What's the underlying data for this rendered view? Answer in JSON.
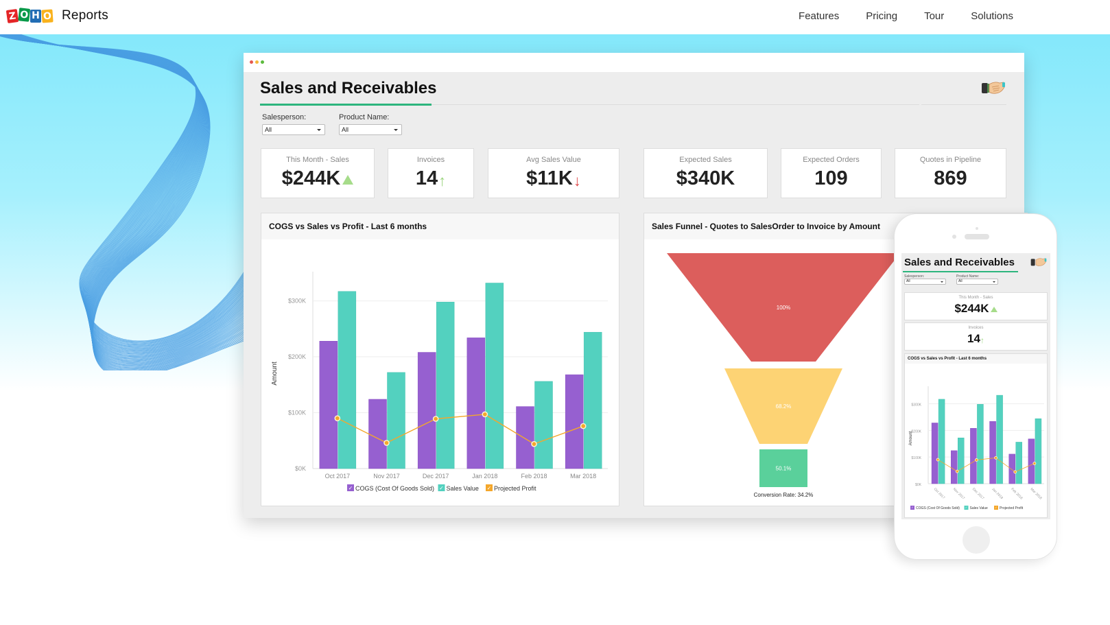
{
  "nav": {
    "logo_letters": [
      "Z",
      "O",
      "H",
      "O"
    ],
    "product_name": "Reports",
    "links": [
      "Features",
      "Pricing",
      "Tour",
      "Solutions"
    ]
  },
  "window": {
    "traffic_lights": [
      "close",
      "minimize",
      "maximize"
    ]
  },
  "dashboard": {
    "title": "Sales and Receivables",
    "header_icon": "handshake-icon",
    "filters": [
      {
        "label": "Salesperson:",
        "value": "All"
      },
      {
        "label": "Product Name:",
        "value": "All"
      }
    ],
    "kpis": [
      {
        "label": "This Month - Sales",
        "value": "$244K",
        "trend": "up-triangle",
        "trend_color": "#a6dc8a"
      },
      {
        "label": "Invoices",
        "value": "14",
        "trend": "up-arrow",
        "trend_glyph": "↑",
        "trend_color": "#9ad47c"
      },
      {
        "label": "Avg Sales Value",
        "value": "$11K",
        "trend": "down-arrow",
        "trend_glyph": "↓",
        "trend_color": "#e0494a"
      },
      {
        "label": "Expected Sales",
        "value": "$340K"
      },
      {
        "label": "Expected Orders",
        "value": "109"
      },
      {
        "label": "Quotes in Pipeline",
        "value": "869"
      }
    ]
  },
  "colors": {
    "accent_green": "#2db57d",
    "cogs": "#9660d0",
    "sales": "#53d1bf",
    "profit": "#f4a72b",
    "funnel": [
      "#dc5e5c",
      "#fdd374",
      "#5ad09b"
    ]
  },
  "chart_data": [
    {
      "type": "bar",
      "title": "COGS vs Sales vs Profit - Last 6 months",
      "xlabel": "",
      "ylabel": "Amount",
      "categories": [
        "Oct 2017",
        "Nov 2017",
        "Dec 2017",
        "Jan 2018",
        "Feb 2018",
        "Mar 2018"
      ],
      "yticks": [
        "$0K",
        "$100K",
        "$200K",
        "$300K"
      ],
      "ytick_values": [
        0,
        100,
        200,
        300
      ],
      "ylim": [
        0,
        340
      ],
      "units": "thousands USD",
      "grid": true,
      "legend_position": "bottom",
      "series": [
        {
          "name": "COGS (Cost Of Goods Sold)",
          "kind": "bar",
          "values": [
            228,
            124,
            208,
            234,
            111,
            168
          ]
        },
        {
          "name": "Sales Value",
          "kind": "bar",
          "values": [
            317,
            172,
            298,
            332,
            156,
            244
          ]
        },
        {
          "name": "Projected Profit",
          "kind": "line",
          "values": [
            90,
            46,
            89,
            97,
            44,
            76
          ]
        }
      ]
    },
    {
      "type": "funnel",
      "title": "Sales Funnel - Quotes to SalesOrder to Invoice by Amount",
      "stages": [
        {
          "label": "100%",
          "value": 100
        },
        {
          "label": "68.2%",
          "value": 68.2
        },
        {
          "label": "50.1%",
          "value": 50.1
        }
      ],
      "footer": "Conversion Rate: 34.2%"
    }
  ],
  "phone": {
    "title": "Sales and Receivables",
    "filters": [
      {
        "label": "Salesperson:",
        "value": "All"
      },
      {
        "label": "Product Name:",
        "value": "All"
      }
    ],
    "kpis": [
      {
        "label": "This Month - Sales",
        "value": "$244K"
      },
      {
        "label": "Invoices",
        "value": "14",
        "trend_glyph": "↑"
      }
    ],
    "chart_title": "COGS vs Sales vs Profit - Last 6 months",
    "legend": [
      "COGS (Cost Of Goods Sold)",
      "Sales Value",
      "Projected Profit"
    ]
  }
}
